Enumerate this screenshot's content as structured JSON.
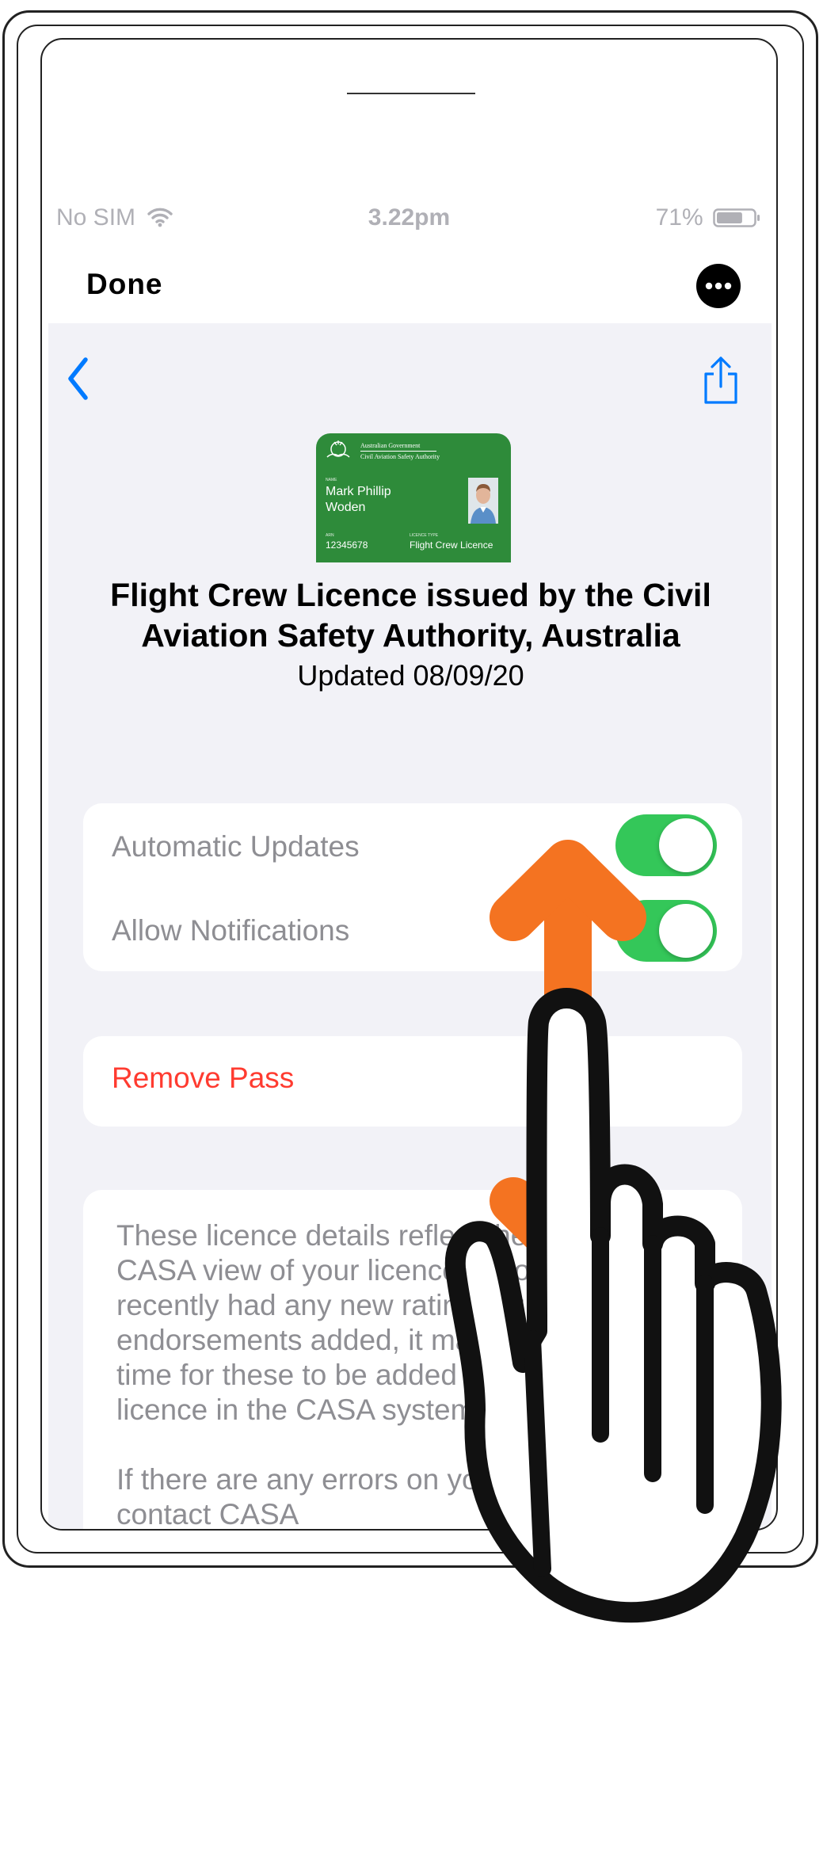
{
  "status_bar": {
    "carrier": "No SIM",
    "time": "3.22pm",
    "battery": "71%",
    "battery_level": 0.71
  },
  "header": {
    "done_label": "Done"
  },
  "nav": {
    "back_icon": "chevron-left-icon",
    "share_icon": "share-icon",
    "more_icon": "ellipsis-icon"
  },
  "card": {
    "gov_line1": "Australian Government",
    "gov_line2": "Civil Aviation Safety Authority",
    "name_label": "NAME",
    "name_line1": "Mark Phillip",
    "name_line2": "Woden",
    "arn_label": "ARN",
    "arn_value": "12345678",
    "licence_type_label": "LICENCE TYPE",
    "licence_type_value": "Flight Crew Licence",
    "card_color": "#2e8b3a"
  },
  "pass": {
    "title_line1": "Flight Crew Licence issued by the Civil",
    "title_line2": "Aviation Safety Authority, Australia",
    "updated": "Updated 08/09/20"
  },
  "settings": [
    {
      "label": "Automatic Updates",
      "on": true
    },
    {
      "label": "Allow Notifications",
      "on": true
    }
  ],
  "remove_label": "Remove Pass",
  "info_lines": [
    "These licence details reflect the current",
    "CASA view of your licence. If you have",
    "recently had any new ratings or",
    "endorsements added, it may take some",
    "time for these to be added to your",
    "licence in the CASA system.",
    "",
    "If there are any errors on your licence",
    "contact CASA"
  ],
  "colors": {
    "accent": "#007aff",
    "toggle_on": "#34c759",
    "destructive": "#ff3b30",
    "gesture_arrow": "#f47321"
  },
  "gesture": {
    "type": "vertical-scroll",
    "icon": "hand-pointer-icon",
    "arrow_icon": "up-down-arrow-icon"
  }
}
